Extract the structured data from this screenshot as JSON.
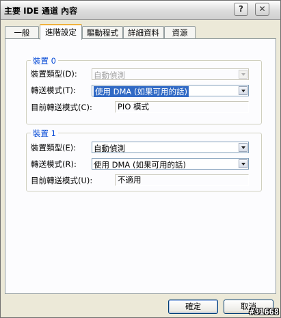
{
  "window": {
    "title": "主要 IDE 通道 內容"
  },
  "title_buttons": {
    "help": "?",
    "close": "✕"
  },
  "tabs": [
    {
      "label": "一般"
    },
    {
      "label": "進階設定"
    },
    {
      "label": "驅動程式"
    },
    {
      "label": "詳細資料"
    },
    {
      "label": "資源"
    }
  ],
  "device0": {
    "title": "裝置 0",
    "type_label": "裝置類型(D):",
    "type_value": "自動偵測",
    "transfer_label": "轉送模式(T):",
    "transfer_value": "使用 DMA (如果可用的話)",
    "current_label": "目前轉送模式(C):",
    "current_value": "PIO 模式"
  },
  "device1": {
    "title": "裝置 1",
    "type_label": "裝置類型(E):",
    "type_value": "自動偵測",
    "transfer_label": "轉送模式(R):",
    "transfer_value": "使用 DMA (如果可用的話)",
    "current_label": "目前轉送模式(U):",
    "current_value": "不適用"
  },
  "buttons": {
    "ok": "確定",
    "cancel": "取消"
  },
  "watermark": "#31668"
}
